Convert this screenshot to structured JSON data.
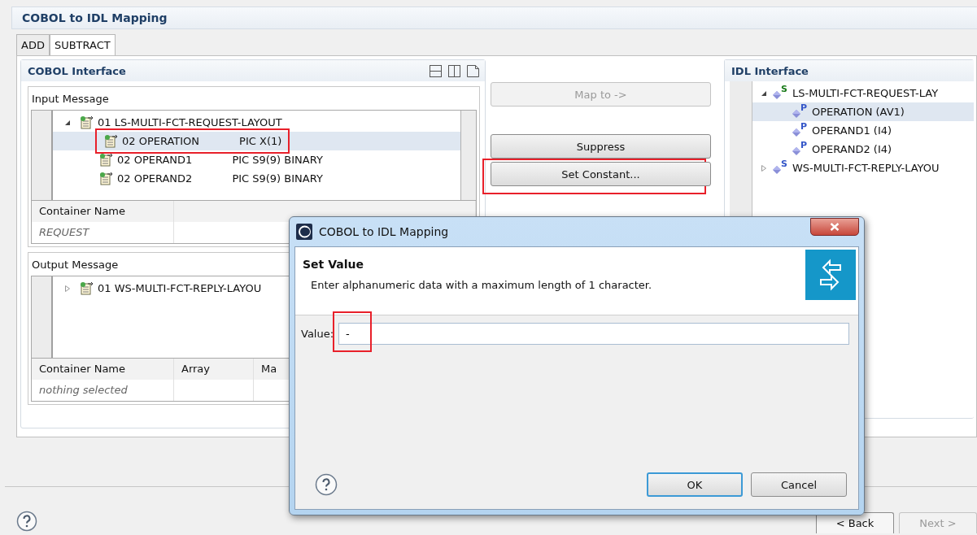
{
  "window": {
    "title": "COBOL to IDL Mapping"
  },
  "tabs": [
    {
      "label": "ADD",
      "selected": false
    },
    {
      "label": "SUBTRACT",
      "selected": true
    }
  ],
  "cobol_interface": {
    "title": "COBOL Interface",
    "input_message": {
      "label": "Input Message",
      "tree": [
        {
          "label": "01 LS-MULTI-FCT-REQUEST-LAYOUT",
          "expanded": true,
          "selected": false,
          "highlighted": false,
          "children": [
            {
              "label": "02 OPERATION",
              "picture": "PIC X(1)",
              "selected": true,
              "highlighted": true
            },
            {
              "label": "02 OPERAND1",
              "picture": "PIC S9(9) BINARY",
              "selected": false,
              "highlighted": false
            },
            {
              "label": "02 OPERAND2",
              "picture": "PIC S9(9) BINARY",
              "selected": false,
              "highlighted": false
            }
          ]
        }
      ],
      "table": {
        "columns": [
          "Container Name"
        ],
        "rows": [
          {
            "cells": [
              "REQUEST"
            ]
          }
        ]
      }
    },
    "output_message": {
      "label": "Output Message",
      "tree": [
        {
          "label": "01 WS-MULTI-FCT-REPLY-LAYOU",
          "expanded": false,
          "selected": false,
          "highlighted": false
        }
      ],
      "table": {
        "columns": [
          "Container Name",
          "Array",
          "Ma"
        ],
        "rows": [
          {
            "cells": [
              "nothing selected"
            ]
          }
        ]
      }
    }
  },
  "actions": [
    {
      "label": "Map to ->",
      "disabled": true,
      "highlighted": false
    },
    {
      "label": "Suppress",
      "disabled": false,
      "highlighted": false
    },
    {
      "label": "Set Constant...",
      "disabled": false,
      "highlighted": true
    }
  ],
  "idl_interface": {
    "title": "IDL Interface",
    "tree": [
      {
        "label": "LS-MULTI-FCT-REQUEST-LAY",
        "badge": "S",
        "expanded": true,
        "selected": false,
        "children": [
          {
            "label": "OPERATION  (AV1)",
            "badge": "P",
            "selected": true
          },
          {
            "label": "OPERAND1  (I4)",
            "badge": "P",
            "selected": false
          },
          {
            "label": "OPERAND2  (I4)",
            "badge": "P",
            "selected": false
          }
        ]
      },
      {
        "label": "WS-MULTI-FCT-REPLY-LAYOU",
        "badge": "S",
        "expanded": false,
        "selected": false
      }
    ]
  },
  "wizard_buttons": [
    {
      "label": "< Back",
      "disabled": false
    },
    {
      "label": "Next >",
      "disabled": true
    }
  ],
  "dialog": {
    "title": "COBOL to IDL Mapping",
    "heading": "Set Value",
    "message": "Enter alphanumeric data with a maximum length of 1 character.",
    "field": {
      "label": "Value:",
      "value": "-",
      "highlighted": true
    },
    "buttons": [
      {
        "label": "OK",
        "default": true
      },
      {
        "label": "Cancel",
        "default": false
      }
    ]
  }
}
